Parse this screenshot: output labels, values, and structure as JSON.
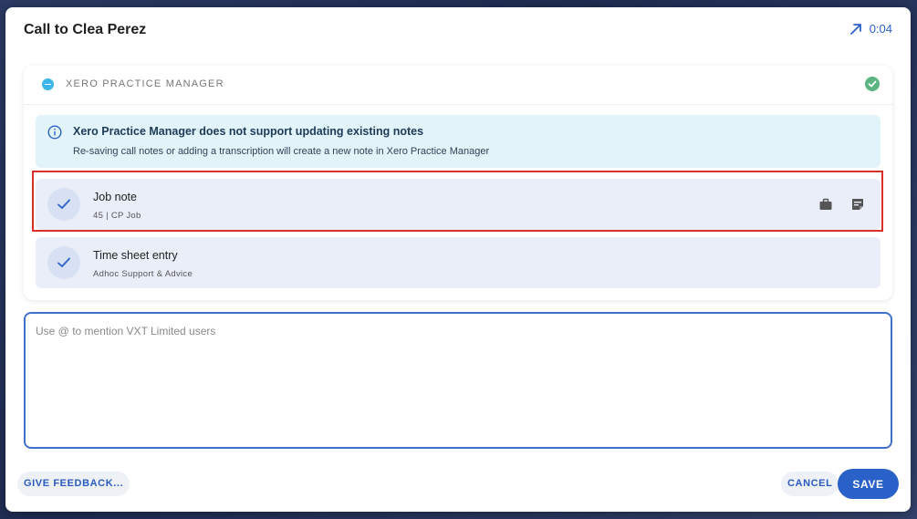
{
  "dialog": {
    "title": "Call to Clea Perez",
    "direction_icon": "arrow-outgoing-icon",
    "duration": "0:04"
  },
  "integration": {
    "logo_icon": "xero-logo-icon",
    "name": "XERO PRACTICE MANAGER",
    "status_icon": "check-circle-icon",
    "status_color": "#5cb481",
    "info": {
      "icon": "info-icon",
      "title": "Xero Practice Manager does not support updating existing notes",
      "text": "Re-saving call notes or adding a transcription will create a new note in Xero Practice Manager"
    },
    "entries": [
      {
        "title": "Job note",
        "subtitle": "45 | CP Job",
        "check_icon": "check-icon",
        "action_icons": [
          "briefcase-icon",
          "note-icon"
        ]
      },
      {
        "title": "Time sheet entry",
        "subtitle": "Adhoc Support & Advice",
        "check_icon": "check-icon"
      }
    ]
  },
  "notes": {
    "placeholder": "Use @ to mention VXT Limited users",
    "value": ""
  },
  "footer": {
    "feedback_label": "GIVE FEEDBACK...",
    "cancel_label": "CANCEL",
    "save_label": "SAVE"
  },
  "colors": {
    "accent": "#2a61c9",
    "highlight": "#d9312a",
    "info_bg": "#e3f3fa",
    "entry_bg": "#e9eef9"
  }
}
